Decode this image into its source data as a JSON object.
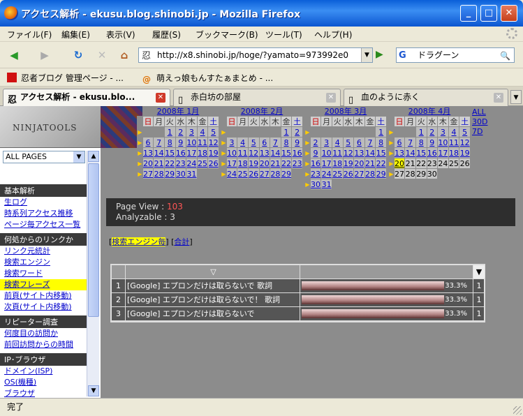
{
  "window": {
    "title": "アクセス解析 - ekusu.blog.shinobi.jp - Mozilla Firefox"
  },
  "menu": [
    "ファイル(F)",
    "編集(E)",
    "表示(V)",
    "履歴(S)",
    "ブックマーク(B)",
    "ツール(T)",
    "ヘルプ(H)"
  ],
  "nav": {
    "url": "http://x8.shinobi.jp/hoge/?yamato=973992e0",
    "search": "ドラグーン"
  },
  "bookmarks": [
    "忍者ブログ 管理ページ - ...",
    "萌えっ娘もんすたぁまとめ - ..."
  ],
  "tabs": [
    "アクセス解析 - ekusu.blo...",
    "赤白坊の部屋",
    "血のように赤く"
  ],
  "sidebar": {
    "logo": "NINJATOOLS",
    "select": "ALL PAGES",
    "sections": [
      {
        "title": "基本解析",
        "links": [
          "生ログ",
          "時系列アクセス推移",
          "ページ毎アクセス一覧"
        ]
      },
      {
        "title": "何処からのリンクか",
        "links": [
          "リンク元統計",
          "検索エンジン",
          "検索ワード",
          "検索フレーズ",
          "前頁(サイト内移動)",
          "次頁(サイト内移動)"
        ]
      },
      {
        "title": "リピーター調査",
        "links": [
          "何度目の訪問か",
          "前回訪問からの時間"
        ]
      },
      {
        "title": "IP･ブラウザ",
        "links": [
          "ドメイン(ISP)",
          "OS(機種)",
          "ブラウザ"
        ]
      }
    ]
  },
  "calendar": {
    "weekdays": [
      "日",
      "月",
      "火",
      "水",
      "木",
      "金",
      "土"
    ],
    "months": [
      {
        "title": "2008年 1月",
        "start": 2,
        "days": 31,
        "today": 0,
        "last_linked": 31
      },
      {
        "title": "2008年 2月",
        "start": 5,
        "days": 29,
        "today": 0,
        "last_linked": 29
      },
      {
        "title": "2008年 3月",
        "start": 6,
        "days": 31,
        "today": 0,
        "last_linked": 31
      },
      {
        "title": "2008年 4月",
        "start": 2,
        "days": 30,
        "today": 20,
        "last_linked": 20
      }
    ],
    "range_links": [
      "ALL",
      "30D",
      "7D"
    ]
  },
  "stats": {
    "page_view_label": "Page View : ",
    "page_view": "103",
    "analyzable_label": "Analyzable : ",
    "analyzable": "3"
  },
  "filter": {
    "open": "[",
    "a": "検索エンジン毎",
    "mid": "] [",
    "b": "合計",
    "close": "]"
  },
  "results": {
    "header_sort": "▽",
    "rows": [
      {
        "rank": "1",
        "phrase": "[Google] エプロンだけは取らないで 歌詞",
        "percent": "33.3%",
        "ratio": 0.333,
        "count": "1"
      },
      {
        "rank": "2",
        "phrase": "[Google] エプロンだけは取らないで！ 歌詞",
        "percent": "33.3%",
        "ratio": 0.333,
        "count": "1"
      },
      {
        "rank": "3",
        "phrase": "[Google] エプロンだけは取らないで",
        "percent": "33.3%",
        "ratio": 0.333,
        "count": "1"
      }
    ]
  },
  "status": "完了"
}
